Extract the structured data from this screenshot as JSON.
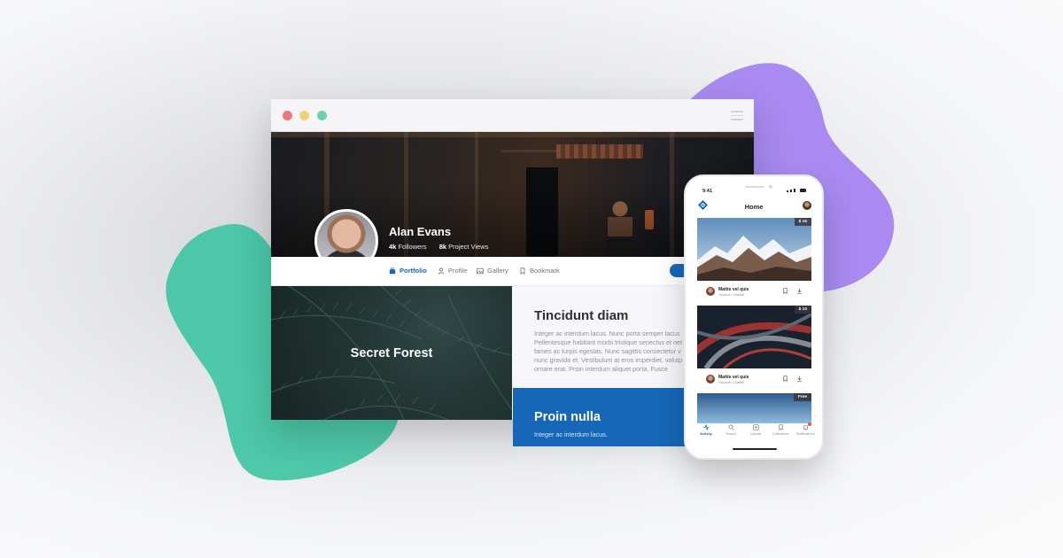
{
  "colors": {
    "accent": "#1767b8",
    "blob_green": "#3cc4a1",
    "blob_purple": "#9e7cf0"
  },
  "browser": {
    "profile": {
      "name": "Alan Evans",
      "followers_count": "4k",
      "followers_label": "Followers",
      "views_count": "8k",
      "views_label": "Project Views"
    },
    "tabs": [
      {
        "label": "Portfolio",
        "icon": "portfolio-icon",
        "active": true
      },
      {
        "label": "Profile",
        "icon": "user-icon",
        "active": false
      },
      {
        "label": "Gallery",
        "icon": "image-icon",
        "active": false
      },
      {
        "label": "Bookmark",
        "icon": "bookmark-icon",
        "active": false
      }
    ],
    "feature": {
      "title": "Secret Forest"
    },
    "article": {
      "title": "Tincidunt diam",
      "lines": [
        "Integer ac interdum lacus. Nunc porta semper lacus",
        "Pellentesque habitant morbi tristique senectus et net",
        "fames ac turpis egestas. Nunc sagittis consectetur v",
        "nunc gravida et. Vestibulum at eros imperdiet, volutp",
        "ornare erat. Proin interdum aliquet porta. Fusce"
      ]
    },
    "promo": {
      "title": "Proin nulla",
      "text": "Integer ac interdum lacus."
    }
  },
  "phone": {
    "time": "9:41",
    "title": "Home",
    "cards": [
      {
        "price": "$ 15",
        "author": "Mattis vel quis",
        "subtitle": "Yaoruch Chaihet"
      },
      {
        "price": "$ 10",
        "author": "Mattis vel quis",
        "subtitle": "Yaoruch Chaihet"
      },
      {
        "price": "Free"
      }
    ],
    "nav": [
      {
        "label": "Activity",
        "icon": "activity-icon",
        "active": true
      },
      {
        "label": "Search",
        "icon": "search-icon",
        "active": false
      },
      {
        "label": "Upload",
        "icon": "upload-icon",
        "active": false
      },
      {
        "label": "Collections",
        "icon": "bookmark-icon",
        "active": false
      },
      {
        "label": "Notifications",
        "icon": "bell-icon",
        "active": false
      }
    ]
  }
}
